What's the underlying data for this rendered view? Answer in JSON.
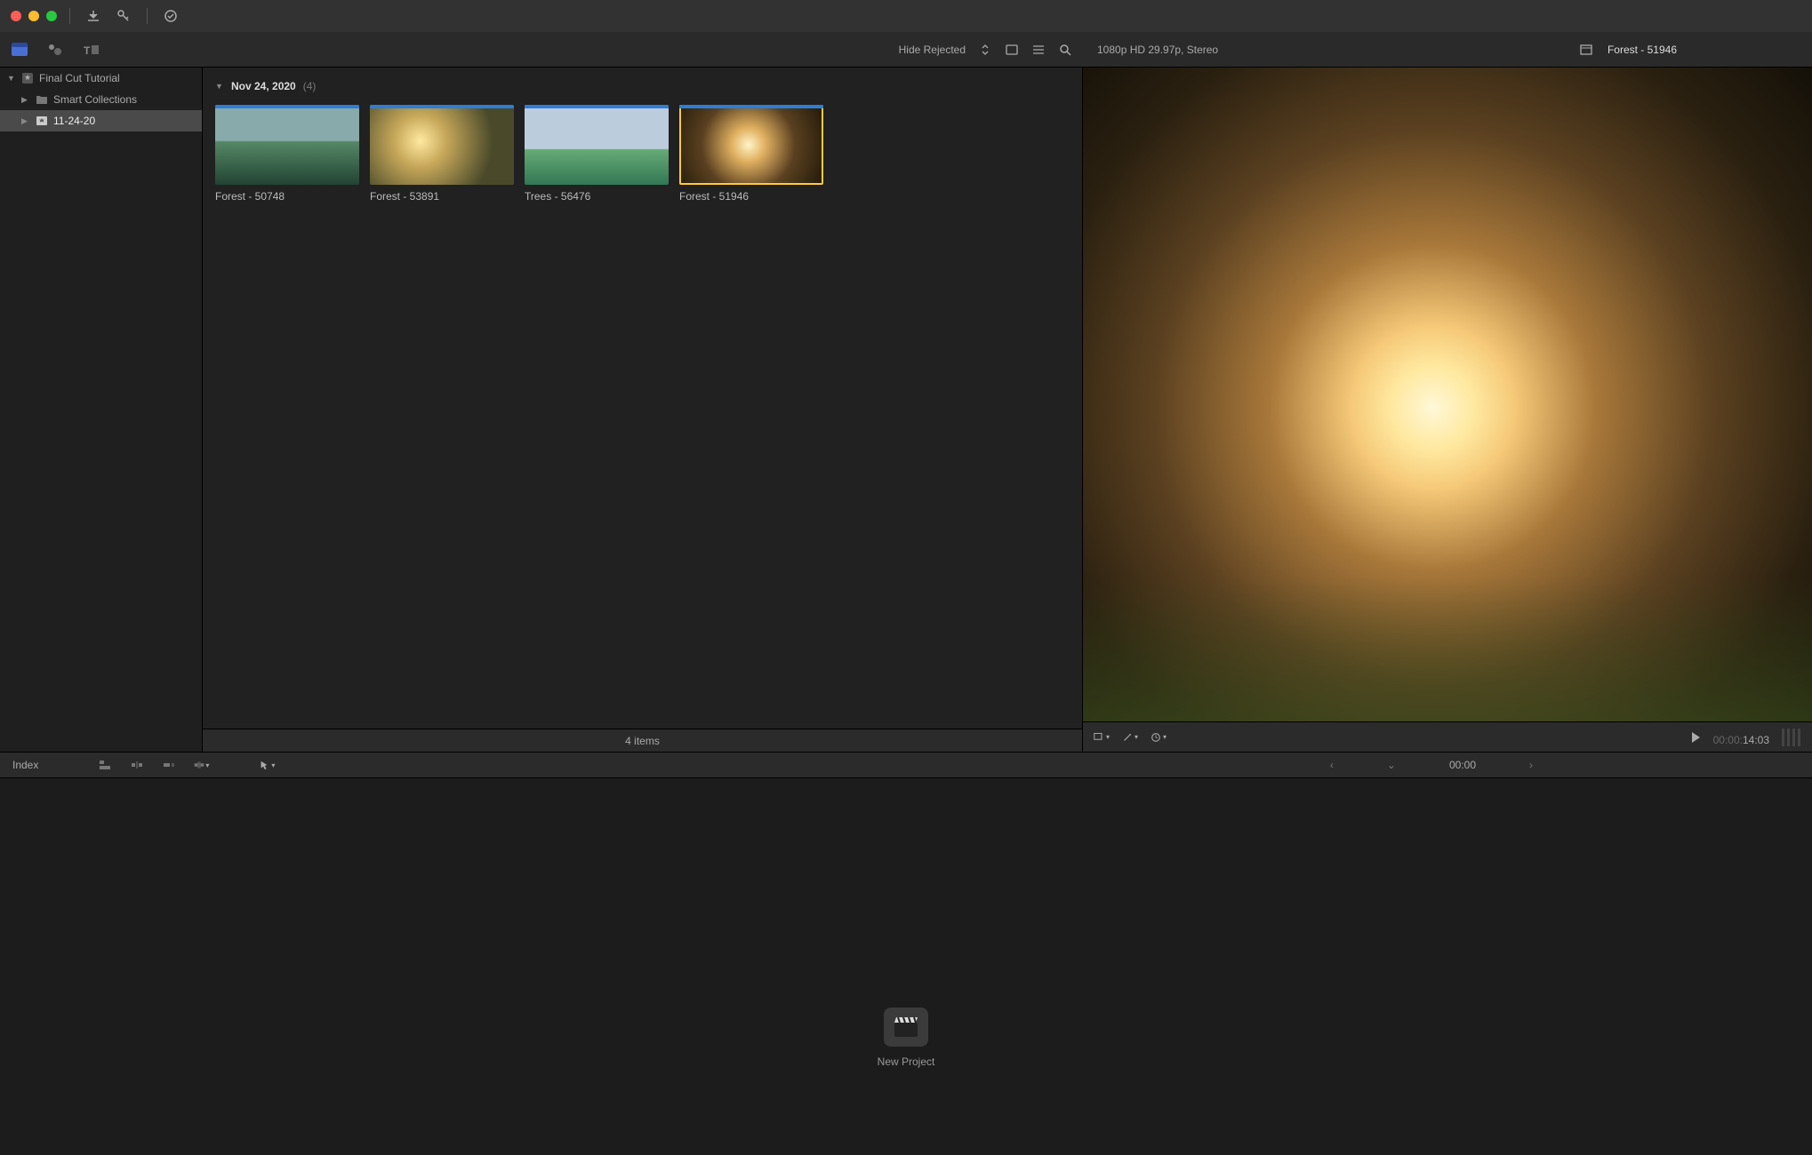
{
  "titlebar": {
    "import": "↓",
    "key": "⌁",
    "bg": "●"
  },
  "tabs": {
    "library": "library",
    "photos": "photos",
    "titles": "titles"
  },
  "sidebar": {
    "items": [
      {
        "label": "Final Cut Tutorial",
        "type": "library"
      },
      {
        "label": "Smart Collections",
        "type": "smart"
      },
      {
        "label": "11-24-20",
        "type": "event"
      }
    ]
  },
  "browser": {
    "filter_label": "Hide Rejected",
    "date": "Nov 24, 2020",
    "count": "(4)",
    "clips": [
      {
        "label": "Forest - 50748"
      },
      {
        "label": "Forest - 53891"
      },
      {
        "label": "Trees - 56476"
      },
      {
        "label": "Forest - 51946"
      }
    ],
    "footer": "4 items"
  },
  "viewer": {
    "format": "1080p HD 29.97p, Stereo",
    "title": "Forest - 51946",
    "tc_dim": "00:00:",
    "tc": "14:03"
  },
  "toolbar2": {
    "index": "Index",
    "zoom_time": "00:00"
  },
  "timeline": {
    "new_project": "New Project"
  }
}
